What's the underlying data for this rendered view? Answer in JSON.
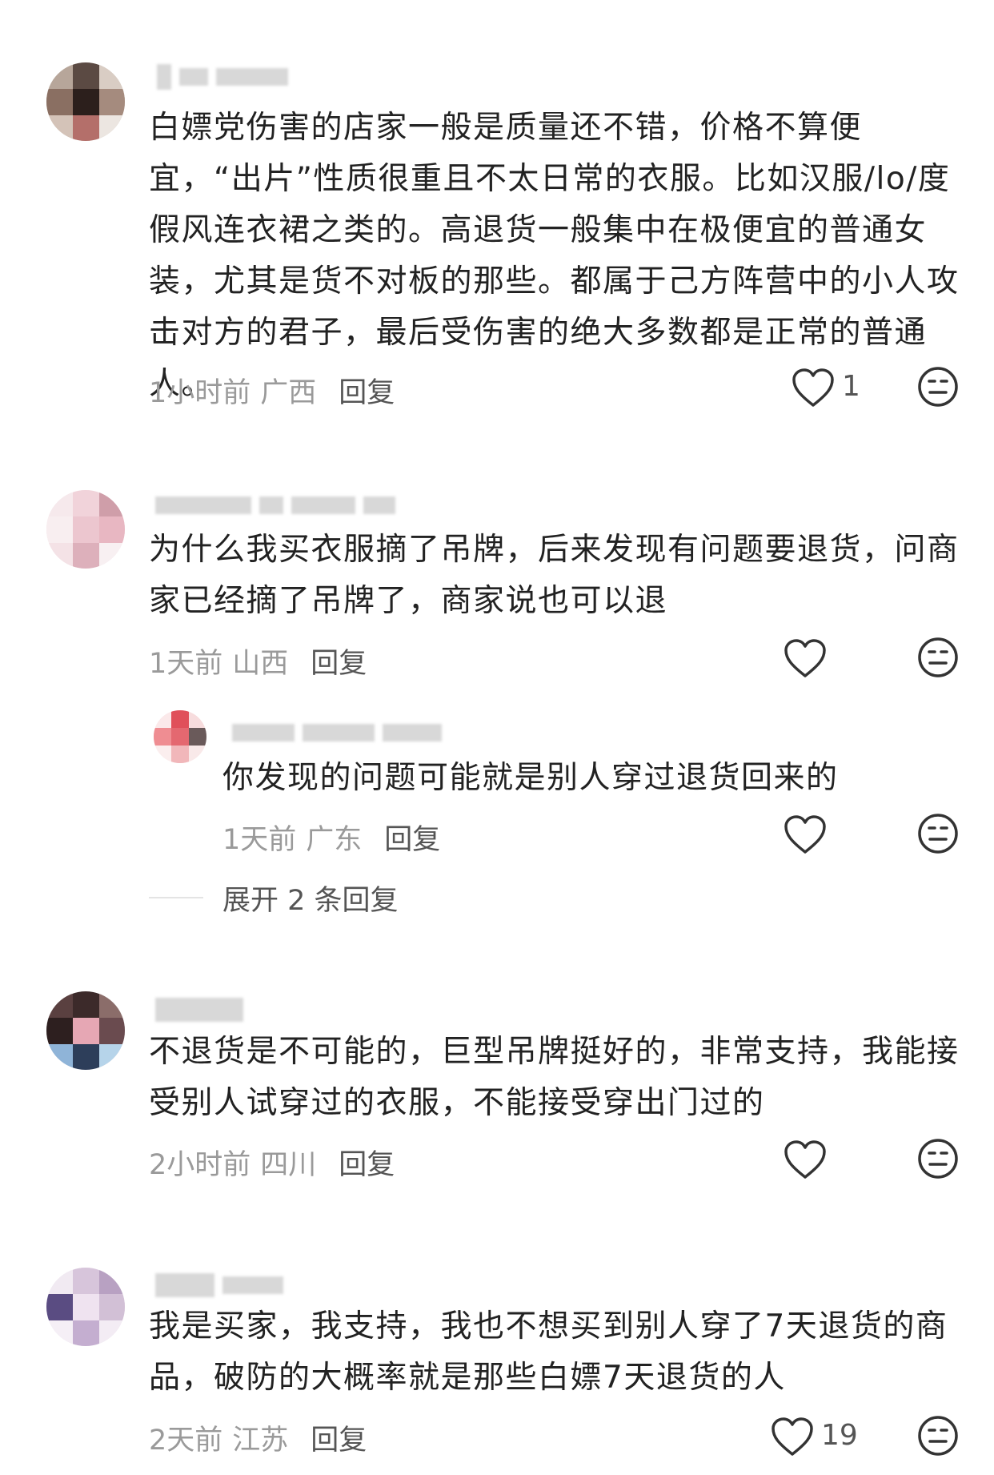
{
  "comments": [
    {
      "text": "白嫖党伤害的店家一般是质量还不错，价格不算便宜，“出片”性质很重且不太日常的衣服。比如汉服/lo/度假风连衣裙之类的。高退货一般集中在极便宜的普通女装，尤其是货不对板的那些。都属于己方阵营中的小人攻击对方的君子，最后受伤害的绝大多数都是正常的普通人。",
      "time": "1小时前",
      "location": "广西",
      "reply_label": "回复",
      "like_count": "1",
      "like_icon": "heart-outline-icon",
      "emoji_icon": "meh-face-icon"
    },
    {
      "text": "为什么我买衣服摘了吊牌，后来发现有问题要退货，问商家已经摘了吊牌了，商家说也可以退",
      "time": "1天前",
      "location": "山西",
      "reply_label": "回复",
      "like_count": "",
      "like_icon": "heart-outline-icon",
      "emoji_icon": "meh-face-icon",
      "sub_reply": {
        "text": "你发现的问题可能就是别人穿过退货回来的",
        "time": "1天前",
        "location": "广东",
        "reply_label": "回复",
        "like_count": ""
      },
      "expand_label": "展开 2 条回复"
    },
    {
      "text": "不退货是不可能的，巨型吊牌挺好的，非常支持，我能接受别人试穿过的衣服，不能接受穿出门过的",
      "time": "2小时前",
      "location": "四川",
      "reply_label": "回复",
      "like_count": "",
      "like_icon": "heart-outline-icon",
      "emoji_icon": "meh-face-icon"
    },
    {
      "text": "我是买家，我支持，我也不想买到别人穿了7天退货的商品，破防的大概率就是那些白嫖7天退货的人",
      "time": "2天前",
      "location": "江苏",
      "reply_label": "回复",
      "like_count": "19",
      "like_icon": "heart-outline-icon",
      "emoji_icon": "meh-face-icon"
    }
  ]
}
